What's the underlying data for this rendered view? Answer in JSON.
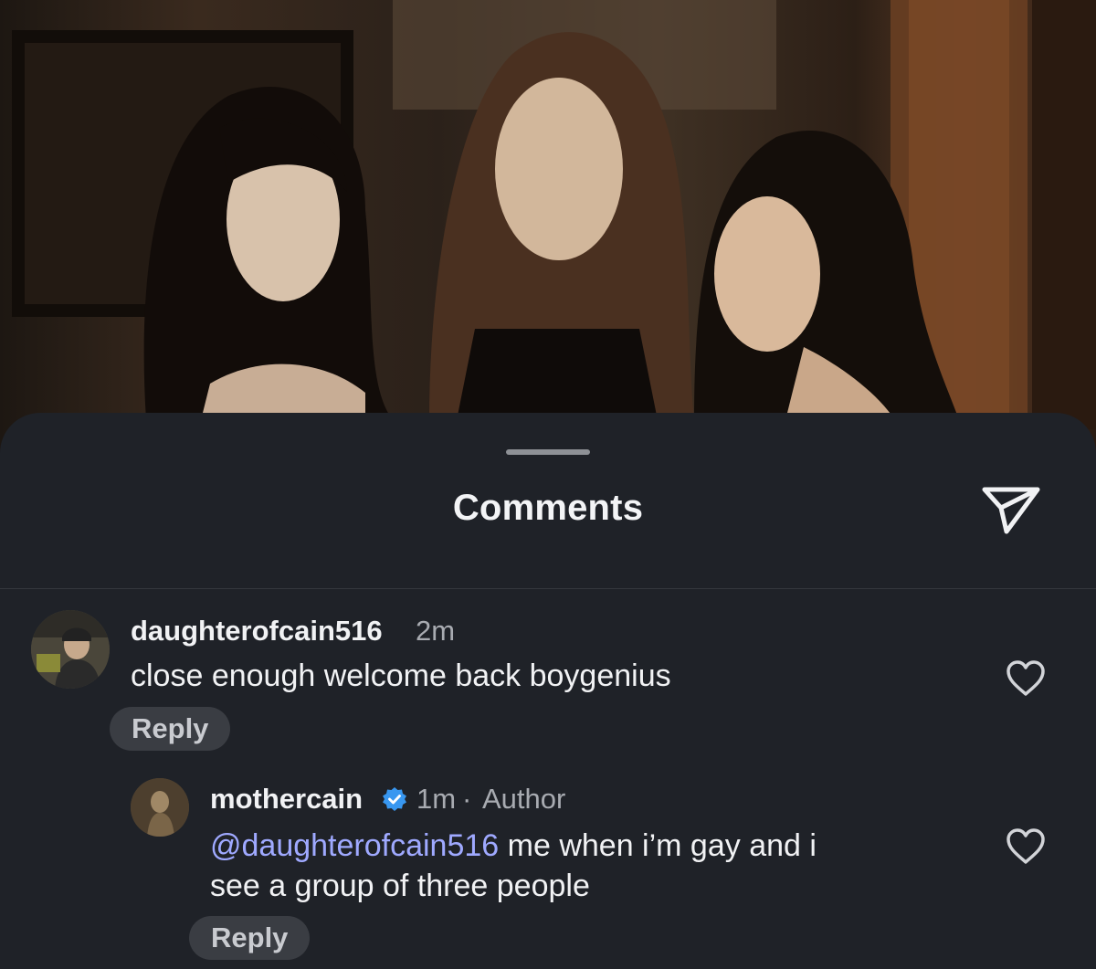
{
  "sheet": {
    "title": "Comments"
  },
  "comments": [
    {
      "username": "daughterofcain516",
      "time": "2m",
      "text": "close enough welcome back boygenius",
      "reply_label": "Reply"
    }
  ],
  "replies": [
    {
      "username": "mothercain",
      "time": "1m",
      "separator": "·",
      "badge": "Author",
      "mention": "@daughterofcain516",
      "text_line1": " me when i’m gay and i",
      "text_line2": "see a group of three people",
      "reply_label": "Reply"
    }
  ],
  "icons": {
    "share": "send-paper-plane-icon",
    "like": "heart-outline-icon",
    "verified": "verified-badge-icon"
  },
  "colors": {
    "sheet_background": "#1f2228",
    "mention": "#9fa9ff",
    "verified": "#3897f0"
  }
}
